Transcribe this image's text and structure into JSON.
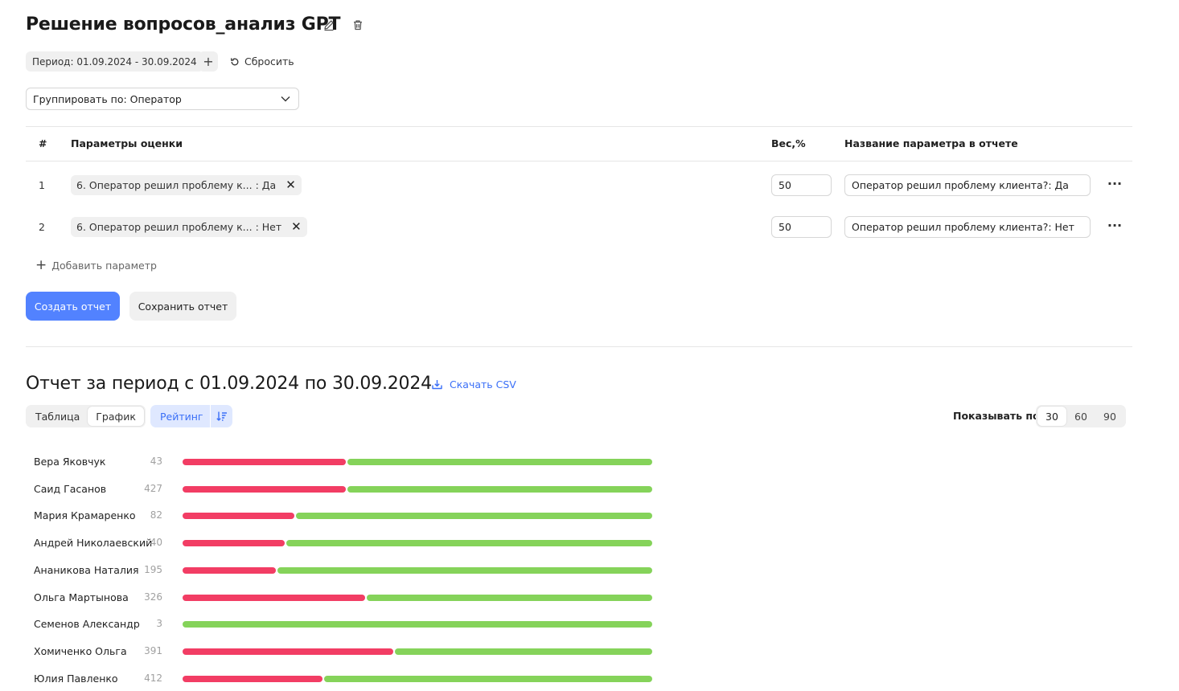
{
  "header": {
    "title": "Решение вопросов_анализ GPT",
    "edit_icon": "pencil-icon",
    "delete_icon": "trash-icon"
  },
  "filters": {
    "period_label": "Период: 01.09.2024 - 30.09.2024",
    "add_label": "+",
    "reset_label": "Сбросить"
  },
  "grouping": {
    "label": "Группировать по: Оператор"
  },
  "params_table": {
    "headers": {
      "num": "#",
      "params": "Параметры оценки",
      "weight": "Вес,%",
      "report_name": "Название параметра в отчете"
    },
    "rows": [
      {
        "num": "1",
        "param": "6. Оператор решил проблему к... : Да",
        "weight": "50",
        "report_name": "Оператор решил проблему клиента?: Да"
      },
      {
        "num": "2",
        "param": "6. Оператор решил проблему к... : Нет",
        "weight": "50",
        "report_name": "Оператор решил проблему клиента?: Нет"
      }
    ],
    "add_param_label": "Добавить параметр"
  },
  "actions": {
    "create_label": "Создать отчет",
    "save_label": "Сохранить отчет"
  },
  "report": {
    "title": "Отчет за период с 01.09.2024 по 30.09.2024",
    "download_label": "Скачать CSV",
    "view_tabs": [
      "Таблица",
      "График"
    ],
    "active_view": "График",
    "rating_label": "Рейтинг",
    "show_by_label": "Показывать по:",
    "page_sizes": [
      "30",
      "60",
      "90"
    ],
    "active_page_size": "30"
  },
  "colors": {
    "primary": "#5282ff",
    "link": "#3a6ff7",
    "bar_negative": "#f23d64",
    "bar_positive": "#85d35a"
  },
  "chart_data": {
    "type": "bar",
    "orientation": "horizontal-stacked-100",
    "categories": [
      "Вера Яковчук",
      "Саид Гасанов",
      "Мария Крамаренко",
      "Андрей Николаевский",
      "Ананикова Наталия",
      "Ольга Мартынова",
      "Семенов Александр",
      "Хомиченко Ольга",
      "Юлия Павленко"
    ],
    "counts": [
      "43",
      "427",
      "82",
      "40",
      "195",
      "326",
      "3",
      "391",
      "412"
    ],
    "series": [
      {
        "values": [
          35,
          35,
          24,
          22,
          20,
          39,
          0,
          45,
          30
        ]
      },
      {
        "values": [
          65,
          65,
          76,
          78,
          80,
          61,
          100,
          55,
          70
        ]
      }
    ],
    "ylim": [
      0,
      100
    ]
  }
}
